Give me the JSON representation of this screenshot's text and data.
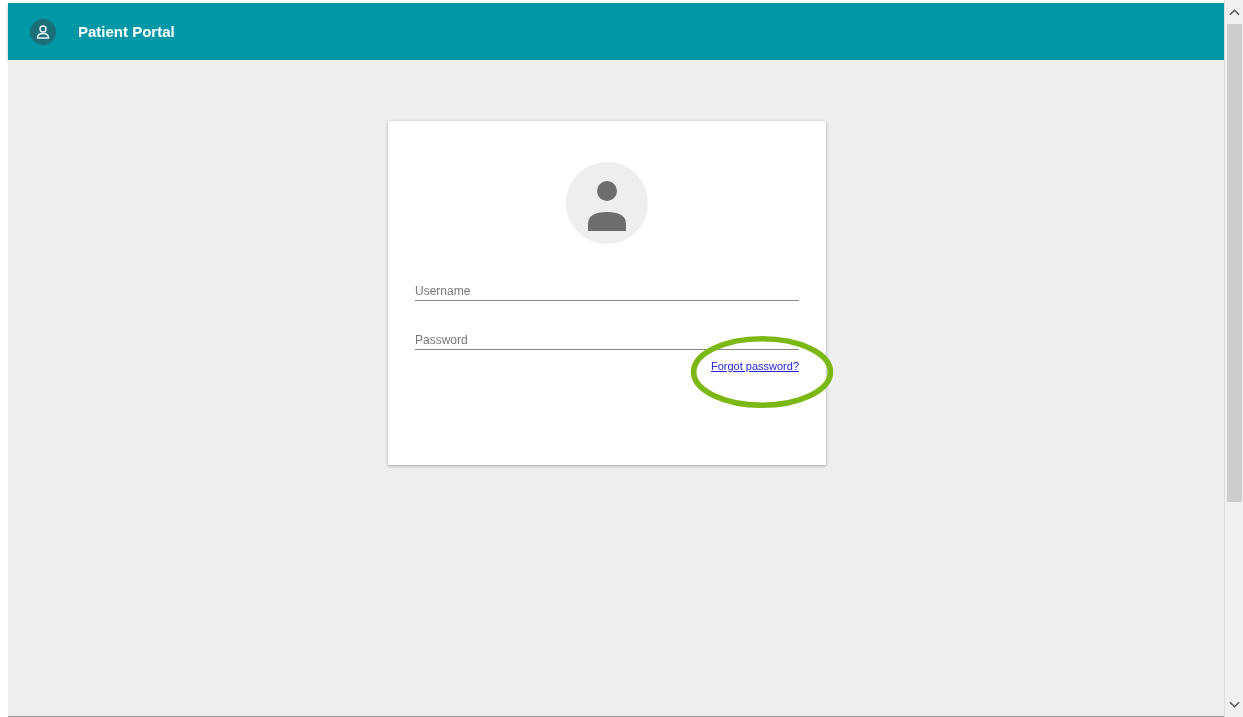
{
  "header": {
    "title": "Patient Portal"
  },
  "login": {
    "username": {
      "placeholder": "Username"
    },
    "password": {
      "placeholder": "Password"
    },
    "forgot_link": "Forgot password?",
    "forgot_highlighted": true
  }
}
